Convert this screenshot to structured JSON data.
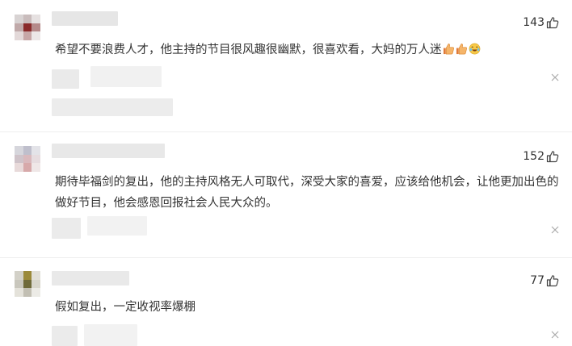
{
  "comments": [
    {
      "text": "希望不要浪费人才，他主持的节目很风趣很幽默，很喜欢看，大妈的万人迷",
      "likes": "143",
      "emojis": [
        "thumbs-up-icon",
        "thumbs-up-icon",
        "laughing-tears-icon"
      ]
    },
    {
      "text": "期待毕福剑的复出，他的主持风格无人可取代，深受大家的喜爱，应该给他机会，让他更加出色的做好节目，他会感恩回报社会人民大众的。",
      "likes": "152",
      "emojis": []
    },
    {
      "text": "假如复出，一定收视率爆棚",
      "likes": "77",
      "emojis": []
    }
  ],
  "colors": {
    "text": "#333333",
    "blur": "#e8e8e8",
    "icon": "#999999"
  }
}
